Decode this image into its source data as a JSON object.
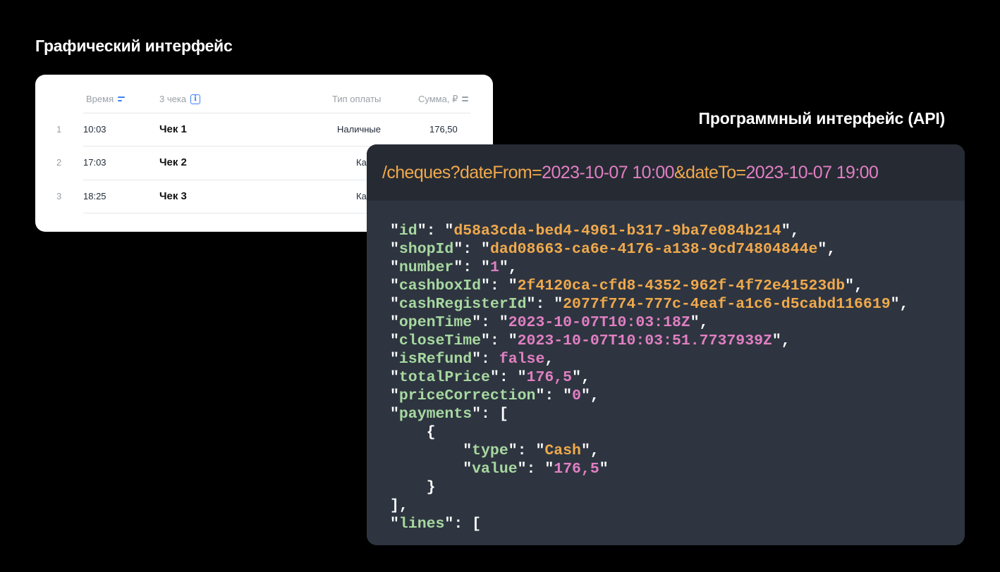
{
  "gui_section": {
    "title": "Графический интерфейс",
    "columns": {
      "time": "Время",
      "cheques": "3 чека",
      "payment_type": "Тип оплаты",
      "sum": "Сумма, ₽"
    },
    "rows": [
      {
        "index": "1",
        "time": "10:03",
        "name": "Чек 1",
        "payment": "Наличные",
        "sum": "176,50"
      },
      {
        "index": "2",
        "time": "17:03",
        "name": "Чек 2",
        "payment": "Ка",
        "sum": ""
      },
      {
        "index": "3",
        "time": "18:25",
        "name": "Чек 3",
        "payment": "Ка",
        "sum": ""
      }
    ]
  },
  "api_section": {
    "title": "Программный интерфейс (API)",
    "request": {
      "path": "/cheques?",
      "param1": "dateFrom=",
      "value1": "2023-10-07 10:00",
      "sep": "&",
      "param2": "dateTo=",
      "value2": "2023-10-07 19:00"
    },
    "response": {
      "id": "d58a3cda-bed4-4961-b317-9ba7e084b214",
      "shopId": "dad08663-ca6e-4176-a138-9cd74804844e",
      "number": "1",
      "cashboxId": "2f4120ca-cfd8-4352-962f-4f72e41523db",
      "cashRegisterId": "2077f774-777c-4eaf-a1c6-d5cabd116619",
      "openTime": "2023-10-07T10:03:18Z",
      "closeTime": "2023-10-07T10:03:51.7737939Z",
      "isRefund": "false",
      "totalPrice": "176,5",
      "priceCorrection": "0",
      "payment_type": "Cash",
      "payment_value": "176,5"
    }
  },
  "colors": {
    "key": "#a7d8a0",
    "string": "#f0a94c",
    "literal": "#e17fc3",
    "panel": "#2e3540",
    "panel_header": "#262b33"
  }
}
